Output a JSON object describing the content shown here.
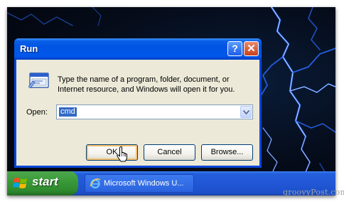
{
  "window": {
    "title": "Run",
    "help_glyph": "?",
    "close_glyph": "✕"
  },
  "dialog": {
    "description": "Type the name of a program, folder, document, or Internet resource, and Windows will open it for you.",
    "open_label": "Open:",
    "open_value": "cmd",
    "ok_label": "OK",
    "cancel_label": "Cancel",
    "browse_label": "Browse..."
  },
  "taskbar": {
    "start_label": "start",
    "task_label": "Microsoft Windows U..."
  },
  "watermark": "groovyPost.com",
  "colors": {
    "title_bar": "#0054e3",
    "window_face": "#ece9d8",
    "selection": "#316ac5",
    "taskbar": "#245edb",
    "start_button": "#3a9a3a"
  },
  "icons": [
    "run-program-icon",
    "help-icon",
    "close-icon",
    "dropdown-arrow-icon",
    "windows-logo-icon",
    "internet-explorer-icon",
    "hand-cursor-icon"
  ]
}
